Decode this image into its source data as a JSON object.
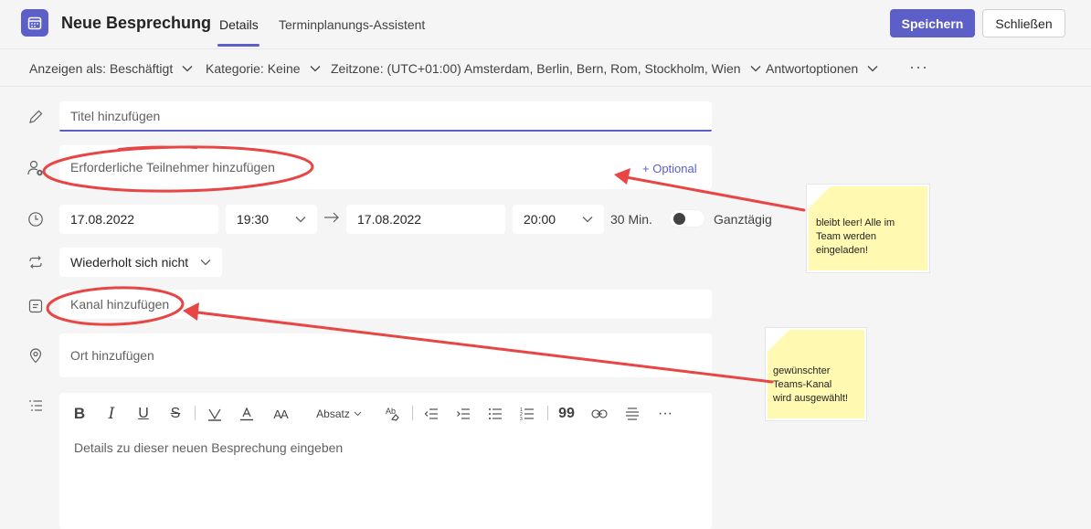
{
  "header": {
    "title": "Neue Besprechung",
    "tabs": [
      {
        "label": "Details",
        "active": true
      },
      {
        "label": "Terminplanungs-Assistent",
        "active": false
      }
    ],
    "save_label": "Speichern",
    "close_label": "Schließen",
    "accent": "#5b5fc7"
  },
  "options": {
    "show_as": "Anzeigen als: Beschäftigt",
    "category": "Kategorie: Keine",
    "timezone": "Zeitzone: (UTC+01:00) Amsterdam, Berlin, Bern, Rom, Stockholm, Wien",
    "response": "Antwortoptionen",
    "more": "···"
  },
  "form": {
    "title_placeholder": "Titel hinzufügen",
    "attendees_placeholder": "Erforderliche Teilnehmer hinzufügen",
    "optional_label": "+ Optional",
    "start_date": "17.08.2022",
    "start_time": "19:30",
    "end_date": "17.08.2022",
    "end_time": "20:00",
    "duration": "30 Min.",
    "all_day_label": "Ganztägig",
    "all_day": false,
    "recurrence": "Wiederholt sich nicht",
    "channel_placeholder": "Kanal hinzufügen",
    "location_placeholder": "Ort hinzufügen"
  },
  "editor": {
    "paragraph_label": "Absatz",
    "placeholder": "Details zu dieser neuen Besprechung eingeben"
  },
  "notes": [
    {
      "lines": [
        "bleibt leer! Alle im",
        "Team werden",
        "eingeladen!"
      ]
    },
    {
      "lines": [
        "gewünschter",
        "Teams-Kanal",
        "wird ausgewählt!"
      ]
    }
  ],
  "annotation_color": "#e84545"
}
